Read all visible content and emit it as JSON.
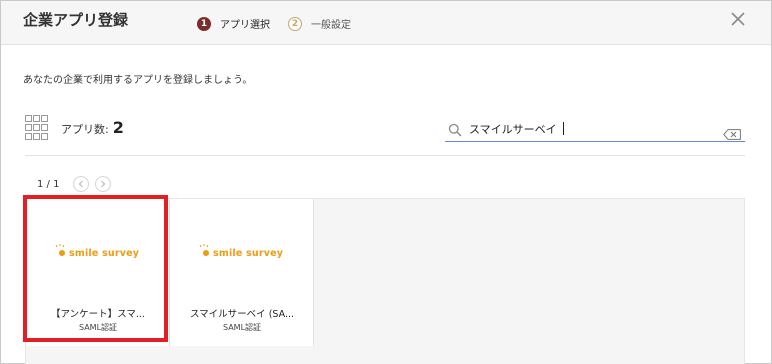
{
  "dialog": {
    "title": "企業アプリ登録",
    "steps": [
      {
        "number": "1",
        "label": "アプリ選択",
        "state": "active"
      },
      {
        "number": "2",
        "label": "一般設定",
        "state": "inactive"
      }
    ],
    "close_icon": "close-icon"
  },
  "main": {
    "description": "あなたの企業で利用するアプリを登録しましょう。",
    "app_count_label": "アプリ数:",
    "app_count_value": "2",
    "grid_icon": "grid-icon"
  },
  "search": {
    "value": "スマイルサーベイ",
    "icon": "search-icon",
    "clear_icon": "clear-input-icon"
  },
  "pager": {
    "text": "1 / 1",
    "prev_icon": "chevron-left-icon",
    "next_icon": "chevron-right-icon"
  },
  "apps": [
    {
      "logo_text": "smile survey",
      "name": "【アンケート】スマ...",
      "auth": "SAML認証",
      "highlighted": true
    },
    {
      "logo_text": "smile survey",
      "name": "スマイルサーベイ (SA...",
      "auth": "SAML認証",
      "highlighted": false
    }
  ],
  "colors": {
    "accent_active_step": "#7a2d2d",
    "inactive_step": "#c9a66b",
    "logo_orange": "#f09a0f",
    "highlight_red": "#e41e25",
    "search_underline": "#5a8ed6"
  }
}
